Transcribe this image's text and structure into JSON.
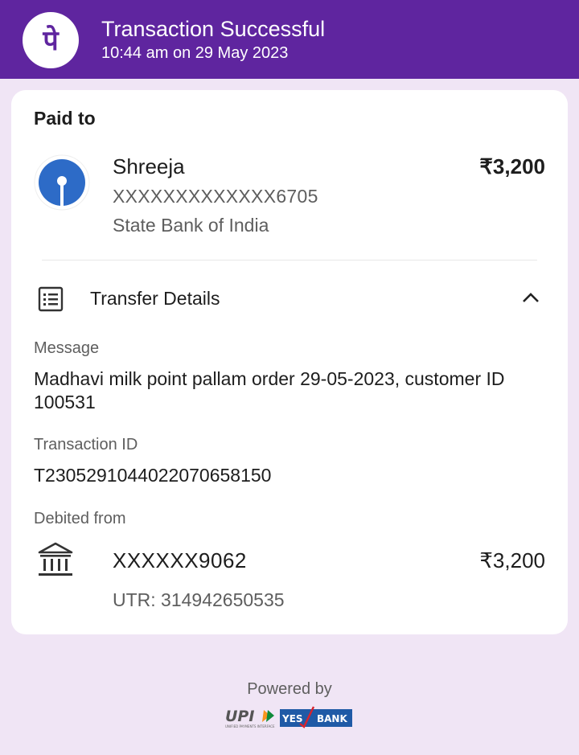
{
  "header": {
    "title": "Transaction Successful",
    "subtitle": "10:44 am on 29 May 2023",
    "logo_icon": "phonepe-logo-icon",
    "logo_glyph": "पे",
    "background_color": "#5f259f"
  },
  "paid_to": {
    "heading": "Paid to",
    "name": "Shreeja",
    "account": "XXXXXXXXXXXXX6705",
    "bank": "State Bank of India",
    "amount": "₹3,200",
    "bank_icon": "sbi-logo-icon"
  },
  "transfer_details": {
    "label": "Transfer Details",
    "icon": "receipt-list-icon",
    "chevron_icon": "chevron-up-icon",
    "expanded": true,
    "message_label": "Message",
    "message_value": "Madhavi milk point pallam order 29-05-2023, customer ID 100531",
    "transaction_id_label": "Transaction ID",
    "transaction_id_value": "T2305291044022070658150",
    "debited_from_label": "Debited from",
    "debited_account": "XXXXXX9062",
    "debited_amount": "₹3,200",
    "utr": "UTR: 314942650535",
    "bank_icon": "bank-building-icon"
  },
  "footer": {
    "powered_by": "Powered by",
    "upi_logo_text": "UPI",
    "upi_tagline": "UNIFIED PAYMENTS INTERFACE",
    "partner_yes": "YES",
    "partner_bank": "BANK"
  },
  "colors": {
    "brand_purple": "#5f259f",
    "page_background": "#f0e5f5",
    "sbi_blue": "#2d6bc7",
    "yes_bank_blue": "#1f5aa6",
    "yes_bank_red": "#d9232d"
  }
}
